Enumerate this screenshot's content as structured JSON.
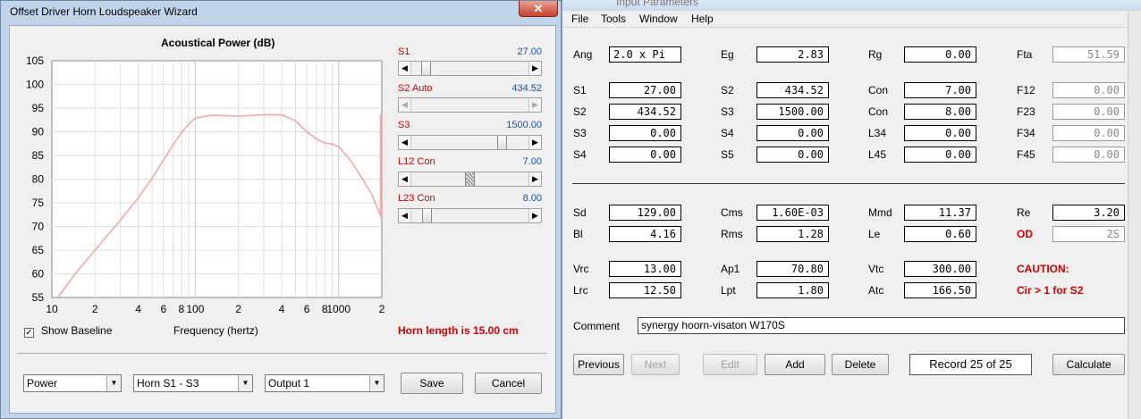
{
  "right_window": {
    "title": "Input Parameters",
    "menu": [
      "File",
      "Tools",
      "Window",
      "Help"
    ],
    "params": {
      "Ang": {
        "label": "Ang",
        "value": "2.0 x Pi"
      },
      "Eg": {
        "label": "Eg",
        "value": "2.83"
      },
      "Rg": {
        "label": "Rg",
        "value": "0.00"
      },
      "Fta": {
        "label": "Fta",
        "value": "51.59"
      },
      "S1a": {
        "label": "S1",
        "value": "27.00"
      },
      "S2b": {
        "label": "S2",
        "value": "434.52"
      },
      "Con1": {
        "label": "Con",
        "value": "7.00"
      },
      "F12": {
        "label": "F12",
        "value": "0.00"
      },
      "S2a": {
        "label": "S2",
        "value": "434.52"
      },
      "S3b": {
        "label": "S3",
        "value": "1500.00"
      },
      "Con2": {
        "label": "Con",
        "value": "8.00"
      },
      "F23": {
        "label": "F23",
        "value": "0.00"
      },
      "S3a": {
        "label": "S3",
        "value": "0.00"
      },
      "S4b": {
        "label": "S4",
        "value": "0.00"
      },
      "L34": {
        "label": "L34",
        "value": "0.00"
      },
      "F34": {
        "label": "F34",
        "value": "0.00"
      },
      "S4a": {
        "label": "S4",
        "value": "0.00"
      },
      "S5b": {
        "label": "S5",
        "value": "0.00"
      },
      "L45": {
        "label": "L45",
        "value": "0.00"
      },
      "F45": {
        "label": "F45",
        "value": "0.00"
      },
      "Sd": {
        "label": "Sd",
        "value": "129.00"
      },
      "Cms": {
        "label": "Cms",
        "value": "1.60E-03"
      },
      "Mmd": {
        "label": "Mmd",
        "value": "11.37"
      },
      "Re": {
        "label": "Re",
        "value": "3.20"
      },
      "Bl": {
        "label": "Bl",
        "value": "4.16"
      },
      "Rms": {
        "label": "Rms",
        "value": "1.28"
      },
      "Le": {
        "label": "Le",
        "value": "0.60"
      },
      "OD": {
        "label": "OD",
        "value": "2S"
      },
      "Vrc": {
        "label": "Vrc",
        "value": "13.00"
      },
      "Ap1": {
        "label": "Ap1",
        "value": "70.80"
      },
      "Vtc": {
        "label": "Vtc",
        "value": "300.00"
      },
      "Lrc": {
        "label": "Lrc",
        "value": "12.50"
      },
      "Lpt": {
        "label": "Lpt",
        "value": "1.80"
      },
      "Atc": {
        "label": "Atc",
        "value": "166.50"
      }
    },
    "caution": {
      "title": "CAUTION:",
      "message": "Cir > 1 for S2"
    },
    "comment": {
      "label": "Comment",
      "value": "synergy hoorn-visaton W170S"
    },
    "buttons": {
      "previous": "Previous",
      "next": "Next",
      "edit": "Edit",
      "add": "Add",
      "delete": "Delete",
      "record": "Record 25 of 25",
      "calculate": "Calculate"
    }
  },
  "wizard": {
    "title": "Offset Driver Horn Loudspeaker Wizard",
    "close_glyph": "✕",
    "sliders": [
      {
        "label": "S1",
        "value": "27.00",
        "position": 0.09
      },
      {
        "label": "S2 Auto",
        "value": "434.52",
        "position": 0.0
      },
      {
        "label": "S3",
        "value": "1500.00",
        "position": 0.8
      },
      {
        "label": "L12 Con",
        "value": "7.00",
        "position": 0.5
      },
      {
        "label": "L23 Con",
        "value": "8.00",
        "position": 0.1
      }
    ],
    "horn_length": "Horn length is 15.00 cm",
    "show_baseline": {
      "label": "Show Baseline",
      "checked": true
    },
    "x_axis_label": "Frequency (hertz)",
    "combos": {
      "mode": "Power",
      "horn": "Horn S1 - S3",
      "output": "Output 1"
    },
    "buttons": {
      "save": "Save",
      "cancel": "Cancel"
    }
  },
  "chart_data": {
    "type": "line",
    "title": "Acoustical Power (dB)",
    "xlabel": "Frequency (hertz)",
    "ylabel": "",
    "x_scale": "log",
    "xlim": [
      10,
      2000
    ],
    "ylim": [
      55,
      105
    ],
    "y_ticks": [
      55,
      60,
      65,
      70,
      75,
      80,
      85,
      90,
      95,
      100,
      105
    ],
    "x_tick_labels": [
      {
        "x": 10,
        "label": "10"
      },
      {
        "x": 20,
        "label": "2"
      },
      {
        "x": 40,
        "label": "4"
      },
      {
        "x": 60,
        "label": "6"
      },
      {
        "x": 80,
        "label": "8"
      },
      {
        "x": 100,
        "label": "100"
      },
      {
        "x": 200,
        "label": "2"
      },
      {
        "x": 400,
        "label": "4"
      },
      {
        "x": 600,
        "label": "6"
      },
      {
        "x": 800,
        "label": "8"
      },
      {
        "x": 1000,
        "label": "1000"
      },
      {
        "x": 2000,
        "label": "2"
      }
    ],
    "grid": true,
    "line_color": "#f0a8a8",
    "series": [
      {
        "x": [
          11,
          15,
          20,
          30,
          40,
          50,
          60,
          70,
          80,
          90,
          100,
          130,
          200,
          300,
          400,
          500,
          600,
          700,
          800,
          900,
          1000,
          1200,
          1400,
          1700,
          2000
        ],
        "y": [
          55,
          60.5,
          65,
          71.3,
          76,
          80.2,
          84,
          87.2,
          89.8,
          91.6,
          92.9,
          93.5,
          93.3,
          93.6,
          93.6,
          92.3,
          90,
          88.5,
          87.6,
          87.4,
          86.9,
          84.1,
          81,
          76.8,
          71.6
        ]
      }
    ]
  }
}
